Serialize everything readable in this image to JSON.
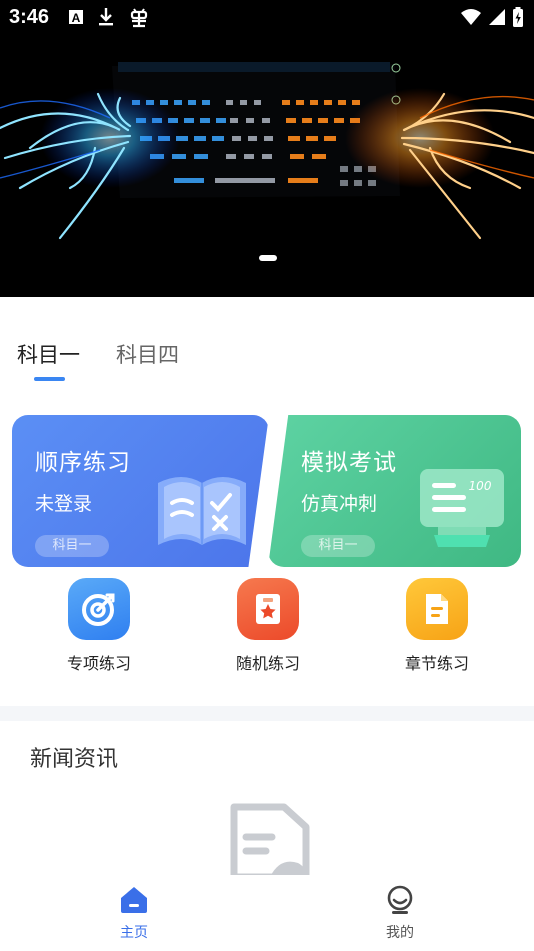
{
  "status_bar": {
    "time": "3:46",
    "left_icons": [
      "a-box-icon",
      "download-icon",
      "bug-icon"
    ],
    "right_icons": [
      "wifi-icon",
      "signal-icon",
      "battery-charging-icon"
    ]
  },
  "banner": {
    "image": "glowing-keyboard-dragons",
    "active_dot": 1,
    "dot_count": 1
  },
  "tabs": [
    {
      "label": "科目一",
      "active": true
    },
    {
      "label": "科目四",
      "active": false
    }
  ],
  "cards": {
    "order": {
      "title": "顺序练习",
      "subtitle": "未登录",
      "tag": "科目一",
      "icon": "book-icon"
    },
    "mock": {
      "title": "模拟考试",
      "subtitle": "仿真冲刺",
      "tag": "科目一",
      "icon": "score-board-icon",
      "icon_text": "100"
    }
  },
  "quick_entries": [
    {
      "label": "专项练习",
      "icon": "target-icon"
    },
    {
      "label": "随机练习",
      "icon": "card-star-icon"
    },
    {
      "label": "章节练习",
      "icon": "document-icon"
    }
  ],
  "news": {
    "title": "新闻资讯",
    "empty_icon": "empty-document-icon"
  },
  "bottom_nav": [
    {
      "label": "主页",
      "icon": "home-icon",
      "active": true
    },
    {
      "label": "我的",
      "icon": "profile-icon",
      "active": false
    }
  ],
  "colors": {
    "accent": "#3a6fe8",
    "tab_indicator": "#3a86f2",
    "order_card": "#4c75ea",
    "mock_card": "#3fb883"
  }
}
